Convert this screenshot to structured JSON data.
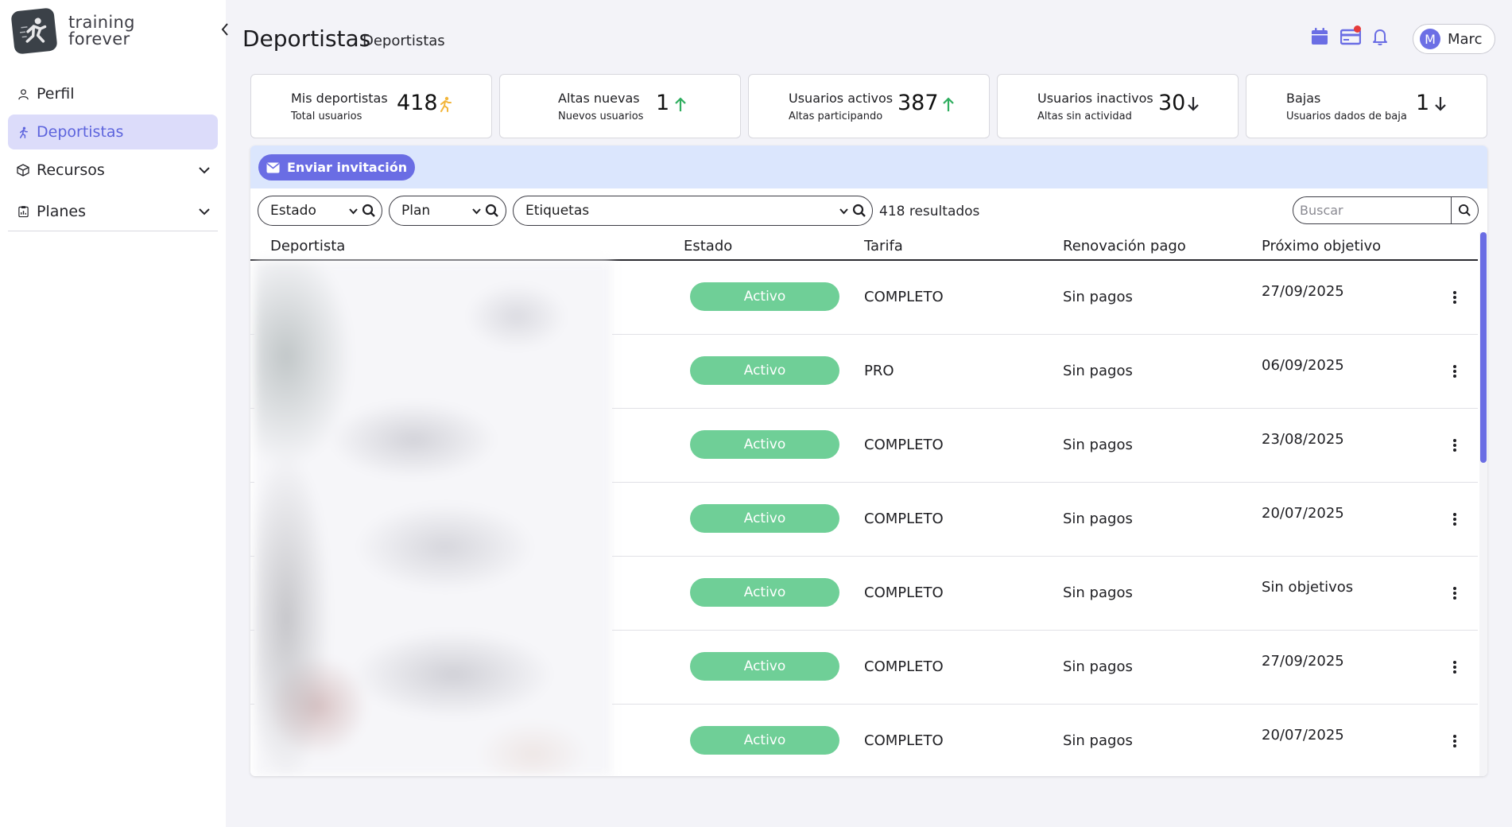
{
  "brand": {
    "line1": "training",
    "line2": "forever"
  },
  "sidebar": {
    "items": [
      {
        "label": "Perfil",
        "icon": "user-icon",
        "active": false
      },
      {
        "label": "Deportistas",
        "icon": "runner-icon",
        "active": true
      },
      {
        "label": "Recursos",
        "icon": "box-icon",
        "active": false,
        "expandable": true
      },
      {
        "label": "Planes",
        "icon": "clipboard-icon",
        "active": false,
        "expandable": true
      }
    ]
  },
  "header": {
    "title": "Deportistas",
    "subtitle": "Deportistas",
    "user": {
      "initial": "M",
      "name": "Marc"
    }
  },
  "stats": [
    {
      "label": "Mis deportistas",
      "sub": "Total usuarios",
      "value": "418",
      "trend": "runner",
      "color": "#f2b53a"
    },
    {
      "label": "Altas nuevas",
      "sub": "Nuevos usuarios",
      "value": "1",
      "trend": "up",
      "color": "#2fae5f"
    },
    {
      "label": "Usuarios activos",
      "sub": "Altas participando",
      "value": "387",
      "trend": "up",
      "color": "#2fae5f"
    },
    {
      "label": "Usuarios inactivos",
      "sub": "Altas sin actividad",
      "value": "30",
      "trend": "down",
      "color": "#26262b"
    },
    {
      "label": "Bajas",
      "sub": "Usuarios dados de baja",
      "value": "1",
      "trend": "down",
      "color": "#26262b"
    }
  ],
  "toolbar": {
    "invite_label": "Enviar invitación"
  },
  "filters": {
    "estado": "Estado",
    "plan": "Plan",
    "etiquetas": "Etiquetas",
    "results": "418 resultados",
    "search_placeholder": "Buscar"
  },
  "table": {
    "columns": [
      "Deportista",
      "Estado",
      "Tarifa",
      "Renovación pago",
      "Próximo objetivo"
    ],
    "rows": [
      {
        "estado": "Activo",
        "tarifa": "COMPLETO",
        "renovacion": "Sin pagos",
        "objetivo": "27/09/2025"
      },
      {
        "estado": "Activo",
        "tarifa": "PRO",
        "renovacion": "Sin pagos",
        "objetivo": "06/09/2025"
      },
      {
        "estado": "Activo",
        "tarifa": "COMPLETO",
        "renovacion": "Sin pagos",
        "objetivo": "23/08/2025"
      },
      {
        "estado": "Activo",
        "tarifa": "COMPLETO",
        "renovacion": "Sin pagos",
        "objetivo": "20/07/2025"
      },
      {
        "estado": "Activo",
        "tarifa": "COMPLETO",
        "renovacion": "Sin pagos",
        "objetivo": "Sin objetivos"
      },
      {
        "estado": "Activo",
        "tarifa": "COMPLETO",
        "renovacion": "Sin pagos",
        "objetivo": "27/09/2025"
      },
      {
        "estado": "Activo",
        "tarifa": "COMPLETO",
        "renovacion": "Sin pagos",
        "objetivo": "20/07/2025"
      }
    ]
  },
  "colors": {
    "accent": "#6a6de4",
    "active_badge": "#6fcf97",
    "active_nav_bg": "#dcdcfa",
    "card_bar": "#dbe6fd"
  }
}
